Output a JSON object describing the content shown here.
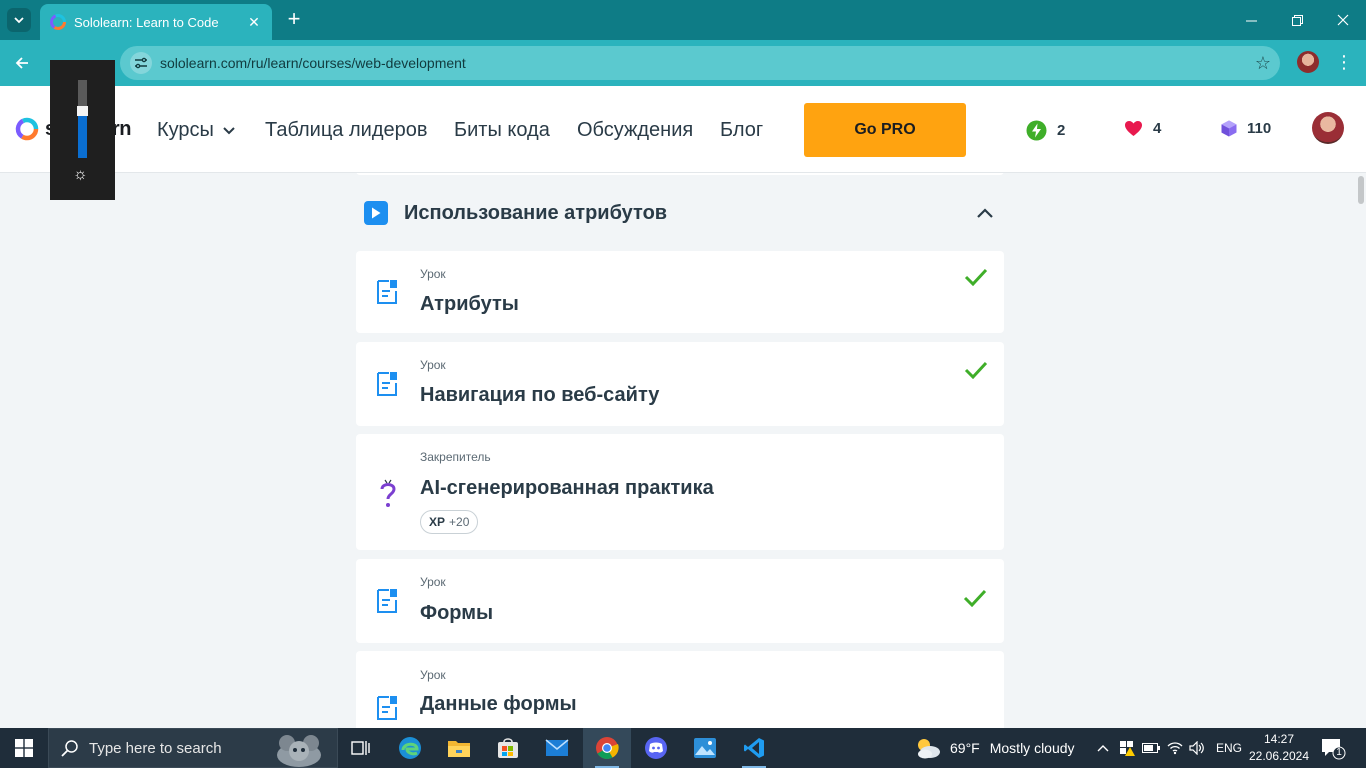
{
  "browser": {
    "tab_title": "Sololearn: Learn to Code",
    "url": "sololearn.com/ru/learn/courses/web-development"
  },
  "header": {
    "logo_text": "sololearn",
    "nav": {
      "courses": "Курсы",
      "leaderboard": "Таблица лидеров",
      "code_bits": "Биты кода",
      "discussions": "Обсуждения",
      "blog": "Блог"
    },
    "go_pro": "Go PRO",
    "stats": {
      "streak": "2",
      "hearts": "4",
      "gems": "110"
    }
  },
  "brightness_level": 0.6,
  "section": {
    "title": "Использование атрибутов",
    "lessons": [
      {
        "type": "Урок",
        "title": "Атрибуты",
        "completed": true
      },
      {
        "type": "Урок",
        "title": "Навигация по веб-сайту",
        "completed": true
      },
      {
        "type": "Закрепитель",
        "title": "AI-сгенерированная практика",
        "completed": false,
        "xp_label": "XP",
        "xp_value": "+20"
      },
      {
        "type": "Урок",
        "title": "Формы",
        "completed": true
      },
      {
        "type": "Урок",
        "title": "Данные формы",
        "completed": false
      }
    ]
  },
  "taskbar": {
    "search_placeholder": "Type here to search",
    "weather_temp": "69°F",
    "weather_desc": "Mostly cloudy",
    "language": "ENG",
    "time": "14:27",
    "date": "22.06.2024",
    "notification_count": "1"
  },
  "colors": {
    "tabbar": "#0e7c86",
    "addressbar": "#2bb3bd",
    "go_pro": "#ffa310",
    "check": "#3fae29",
    "accent_blue": "#1d8ff0",
    "practice_purple": "#7b3fd0"
  }
}
